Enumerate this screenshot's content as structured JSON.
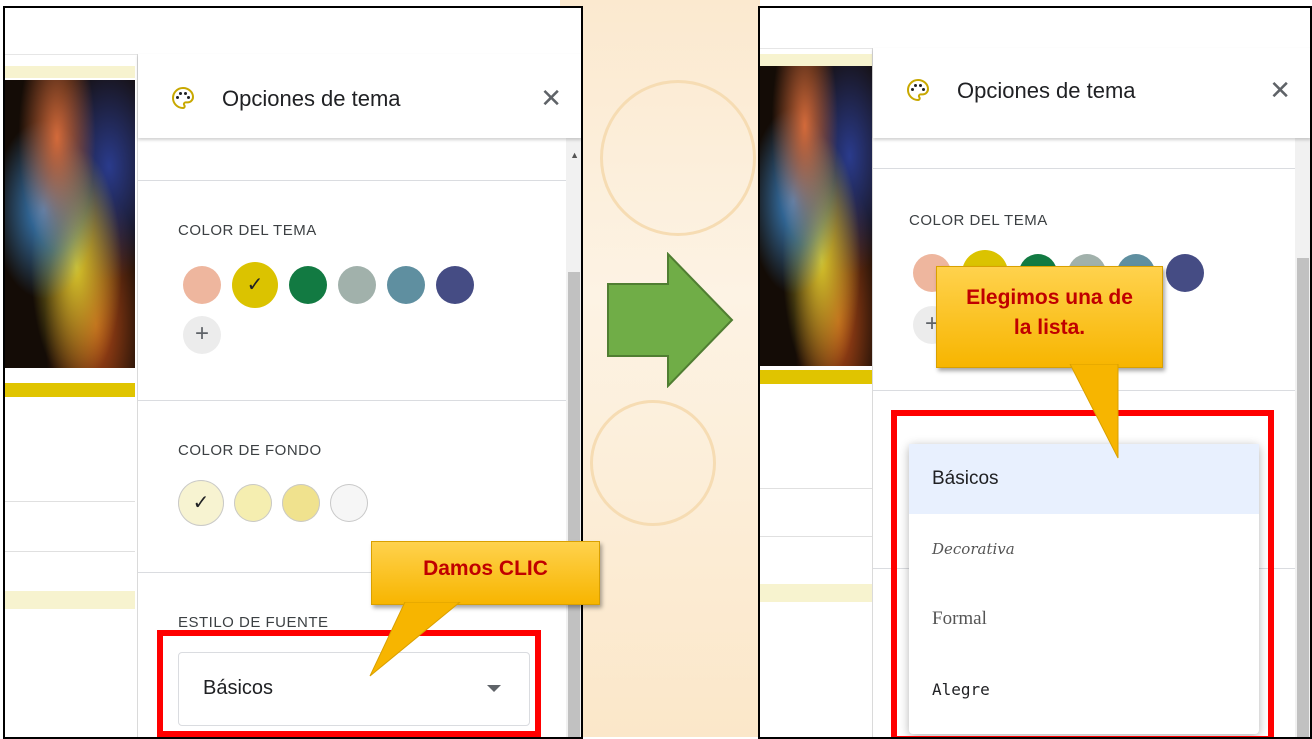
{
  "left_step": {
    "panel": {
      "title": "Opciones de tema",
      "close_icon": "close-icon",
      "palette_icon": "palette-icon"
    },
    "theme_color": {
      "label": "COLOR DEL TEMA",
      "swatches": [
        "#eeb69e",
        "#dbc300",
        "#127a42",
        "#a1b1ab",
        "#5f8fa0",
        "#454c84"
      ],
      "selected_index": 1,
      "add_label": "+"
    },
    "background_color": {
      "label": "COLOR DE FONDO",
      "swatches": [
        "#f7f3d1",
        "#f5eeb0",
        "#f0e28e",
        "#f6f6f6"
      ],
      "selected_index": 0
    },
    "font_style": {
      "label": "ESTILO DE FUENTE",
      "selected": "Básicos"
    },
    "callout": "Damos CLIC"
  },
  "right_step": {
    "panel": {
      "title": "Opciones de tema"
    },
    "theme_color": {
      "label": "COLOR DEL TEMA"
    },
    "font_menu": {
      "options": [
        "Básicos",
        "Decorativa",
        "Formal",
        "Alegre"
      ],
      "active_index": 0
    },
    "callout": "Elegimos una de la lista."
  },
  "colors": {
    "highlight_red": "#ff0000",
    "callout_yellow": "#ffc000",
    "callout_text": "#c00000",
    "arrow_green": "#70ad47"
  }
}
